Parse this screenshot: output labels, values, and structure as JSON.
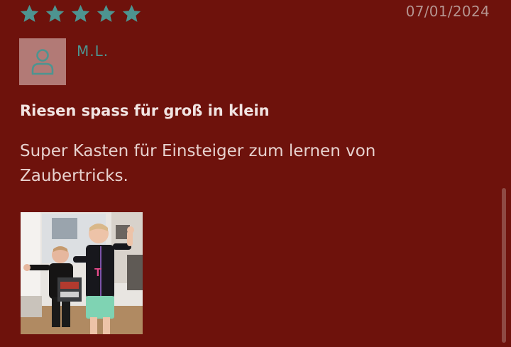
{
  "review": {
    "rating": 5,
    "max_rating": 5,
    "date": "07/01/2024",
    "author": "M.L.",
    "title": "Riesen spass für groß in klein",
    "body": "Super Kasten für Einsteiger zum lernen von Zaubertricks.",
    "photo_icon": "review-photo"
  },
  "colors": {
    "background": "#6e120c",
    "star": "#4d9490",
    "avatar_bg": "#b27a76"
  }
}
